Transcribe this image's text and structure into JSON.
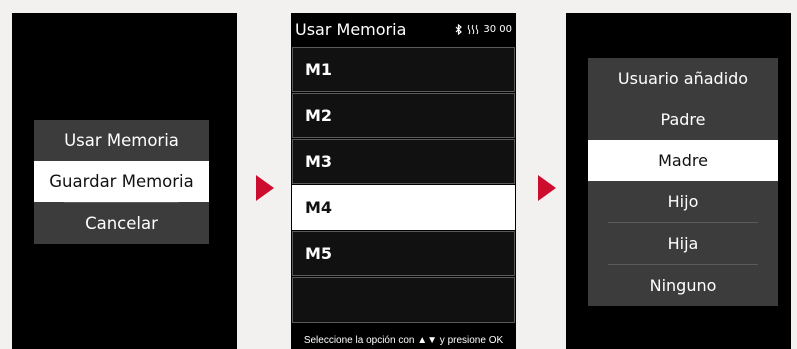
{
  "left_screen": {
    "menu": [
      {
        "label": "Usar Memoria",
        "selected": false
      },
      {
        "label": "Guardar Memoria",
        "selected": true
      },
      {
        "label": "Cancelar",
        "selected": false
      }
    ]
  },
  "middle_screen": {
    "title": "Usar Memoria",
    "status": {
      "bluetooth_icon": "bluetooth-icon",
      "heat_icon": "heat-waves-icon",
      "timer": "30 00"
    },
    "items": [
      {
        "label": "M1",
        "selected": false
      },
      {
        "label": "M2",
        "selected": false
      },
      {
        "label": "M3",
        "selected": false
      },
      {
        "label": "M4",
        "selected": true
      },
      {
        "label": "M5",
        "selected": false
      },
      {
        "label": "",
        "selected": false
      }
    ],
    "footer": "Seleccione la opción con ▲▼ y presione OK"
  },
  "right_screen": {
    "title": "Usuario añadido",
    "options": [
      {
        "label": "Padre",
        "selected": false
      },
      {
        "label": "Madre",
        "selected": true
      },
      {
        "label": "Hijo",
        "selected": false
      },
      {
        "label": "Hija",
        "selected": false
      },
      {
        "label": "Ninguno",
        "selected": false
      }
    ]
  },
  "colors": {
    "screen": "#000000",
    "menu_bg": "#3c3c3c",
    "highlight": "#ffffff",
    "arrow": "#cc0d2e",
    "page_bg": "#f2f1ef"
  }
}
